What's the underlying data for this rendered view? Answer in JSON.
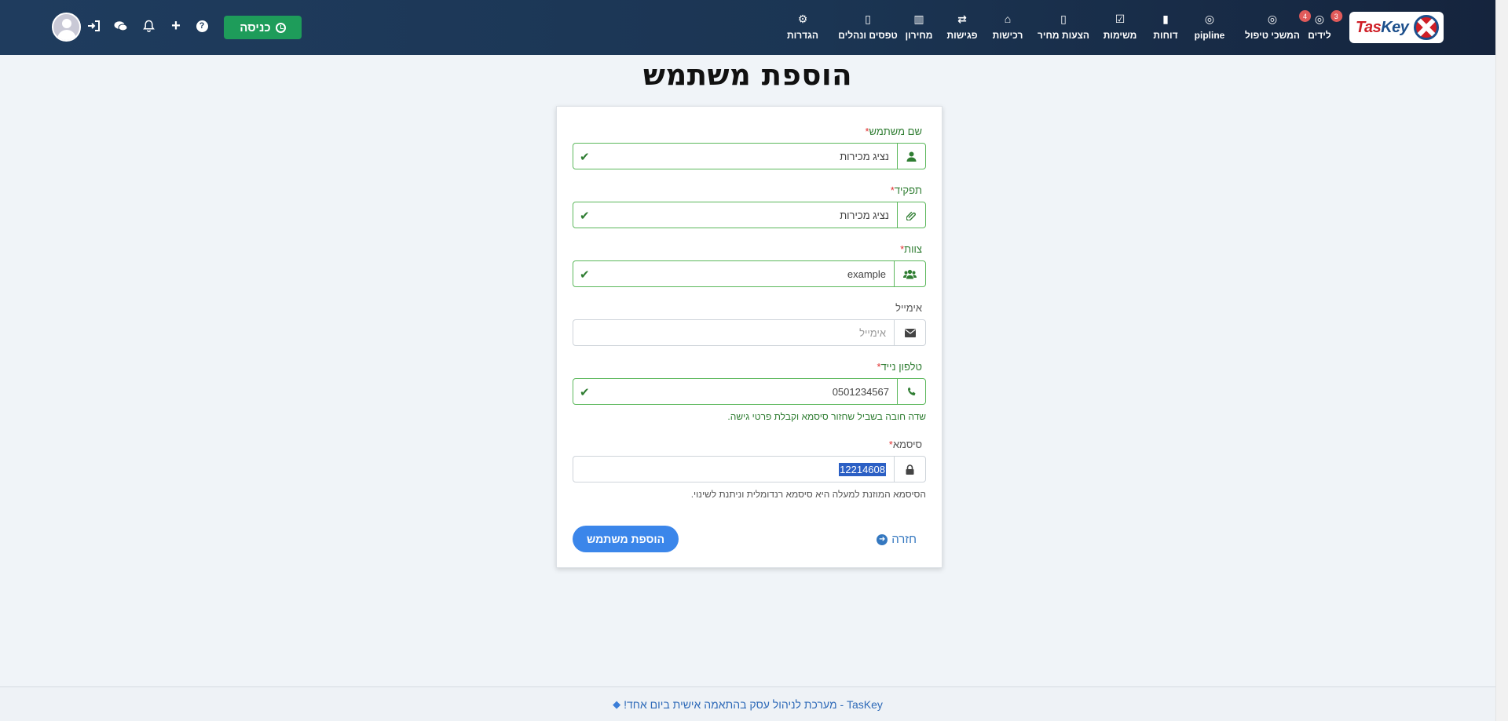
{
  "app": {
    "logo_text_1": "Tas",
    "logo_text_2": "Key"
  },
  "nav": {
    "items": [
      {
        "key": "leads",
        "label": "לידים",
        "icon": "◎",
        "badge": "3"
      },
      {
        "key": "followups",
        "label": "המשכי טיפול",
        "icon": "◎",
        "badge": "4"
      },
      {
        "key": "pipline",
        "label": "pipline",
        "icon": "◎",
        "badge": ""
      },
      {
        "key": "reports",
        "label": "דוחות",
        "icon": "▮",
        "badge": ""
      },
      {
        "key": "tasks",
        "label": "משימות",
        "icon": "☑",
        "badge": ""
      },
      {
        "key": "quotes",
        "label": "הצעות מחיר",
        "icon": "▯",
        "badge": ""
      },
      {
        "key": "purchases",
        "label": "רכישות",
        "icon": "⌂",
        "badge": ""
      },
      {
        "key": "meetings",
        "label": "פגישות",
        "icon": "⇄",
        "badge": ""
      },
      {
        "key": "pricelist",
        "label": "מחירון",
        "icon": "▥",
        "badge": ""
      },
      {
        "key": "forms",
        "label": "טפסים ונהלים",
        "icon": "▯",
        "badge": ""
      },
      {
        "key": "settings",
        "label": "הגדרות",
        "icon": "⚙",
        "badge": ""
      }
    ],
    "enter_button": "כניסה",
    "tools": {
      "help": "?",
      "add": "+",
      "bell": "🔔",
      "chat": "💬",
      "login": "⇥"
    }
  },
  "page": {
    "title": "הוספת משתמש"
  },
  "form": {
    "username": {
      "label": "שם משתמש",
      "required": "*",
      "value": "נציג מכירות",
      "icon": "user-icon"
    },
    "role": {
      "label": "תפקיד",
      "required": "*",
      "value": "נציג מכירות",
      "icon": "tag-icon"
    },
    "team": {
      "label": "צוות",
      "required": "*",
      "value": "example",
      "icon": "users-icon"
    },
    "email": {
      "label": "אימייל",
      "required": "",
      "placeholder": "אימייל",
      "icon": "envelope-icon"
    },
    "phone": {
      "label": "טלפון נייד",
      "required": "*",
      "value": "0501234567",
      "icon": "phone-icon",
      "help": "שדה חובה בשביל שחזור סיסמא וקבלת פרטי גישה."
    },
    "password": {
      "label": "סיסמא",
      "required": "*",
      "value": "12214608",
      "icon": "lock-icon",
      "help": "הסיסמא המוזנת למעלה היא סיסמא רנדומלית וניתנת לשינוי."
    },
    "submit_label": "הוספת משתמש",
    "back_label": "חזרה"
  },
  "footer": {
    "text": "TasKey - מערכת לניהול עסק בהתאמה אישית ביום אחד!"
  },
  "colors": {
    "nav_bg": "#1f3c5e",
    "enter_green": "#1e9c5a",
    "primary_blue": "#3b86ea",
    "valid_green": "#2f7d32"
  }
}
